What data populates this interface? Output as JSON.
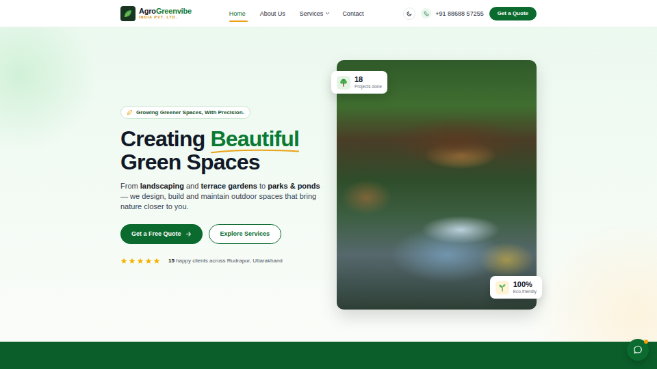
{
  "header": {
    "logo": {
      "word1": "Agro",
      "word2": "Greenvibe",
      "tagline": "INDIA PVT. LTD."
    },
    "nav": [
      {
        "label": "Home",
        "selected": true,
        "has_dropdown": false
      },
      {
        "label": "About Us",
        "selected": false,
        "has_dropdown": false
      },
      {
        "label": "Services",
        "selected": false,
        "has_dropdown": true
      },
      {
        "label": "Contact",
        "selected": false,
        "has_dropdown": false
      }
    ],
    "phone": "+91 88688 57255",
    "cta": "Get a Quote"
  },
  "hero": {
    "badge": "Growing Greener Spaces, With Precision.",
    "title_start": "Creating",
    "title_highlight": "Beautiful",
    "title_end": "Green Spaces",
    "description": [
      {
        "text": "From ",
        "bold": false
      },
      {
        "text": "landscaping",
        "bold": true
      },
      {
        "text": " and ",
        "bold": false
      },
      {
        "text": "terrace gardens",
        "bold": true
      },
      {
        "text": " to ",
        "bold": false
      },
      {
        "text": "parks & ponds",
        "bold": true
      },
      {
        "text": " — we design, build and maintain outdoor spaces that bring nature closer to you.",
        "bold": false
      }
    ],
    "buttons": [
      {
        "label": "Get a Free Quote",
        "kind": "primary"
      },
      {
        "label": "Explore Services",
        "kind": "outline"
      }
    ],
    "rating": {
      "stars": 5,
      "count": "15",
      "text": "happy clients across Rudrapur, Uttarakhand"
    },
    "stats": [
      {
        "value": "18",
        "label": "Projects done"
      },
      {
        "value": "100%",
        "label": "Eco-friendly"
      }
    ]
  }
}
